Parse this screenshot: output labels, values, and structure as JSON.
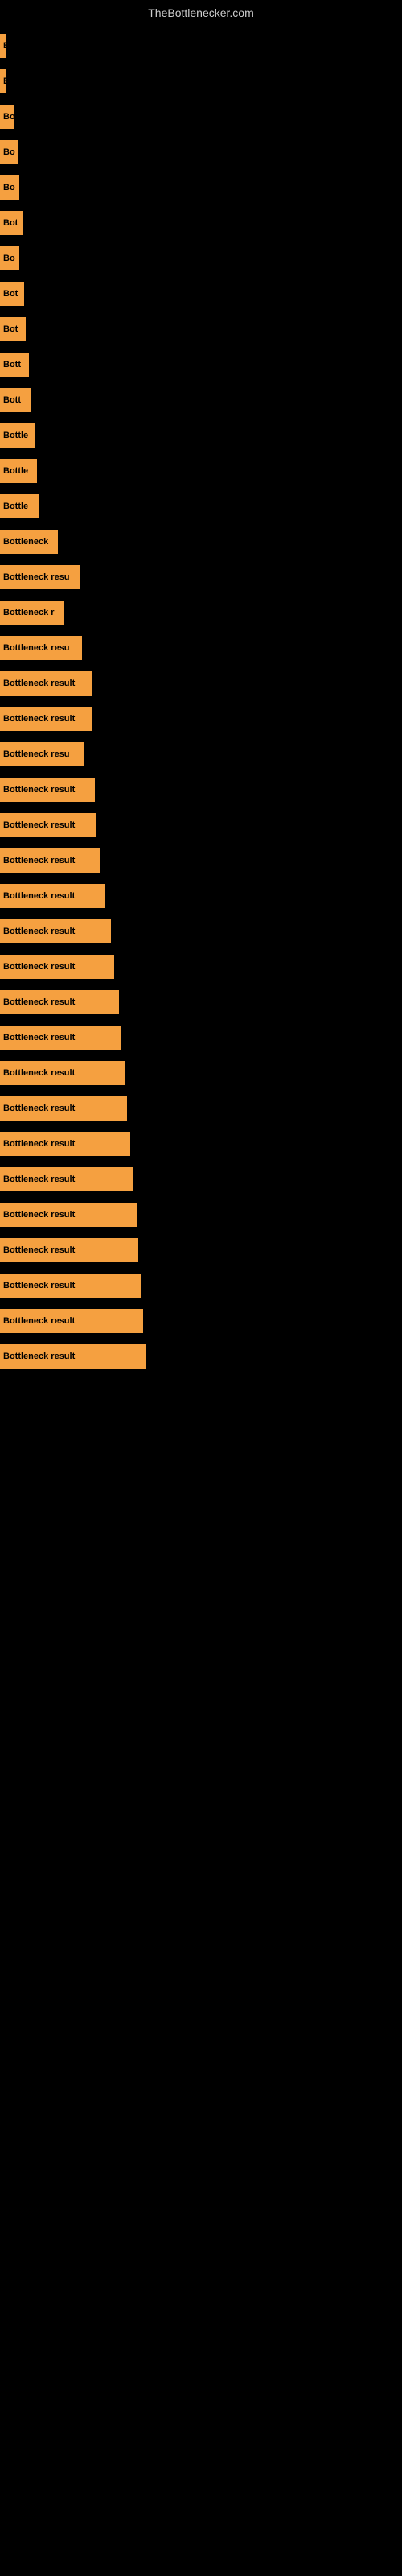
{
  "header": {
    "title": "TheBottlenecker.com"
  },
  "bars": [
    {
      "label": "B",
      "width": 8
    },
    {
      "label": "B",
      "width": 8
    },
    {
      "label": "Bo",
      "width": 18
    },
    {
      "label": "Bo",
      "width": 22
    },
    {
      "label": "Bo",
      "width": 24
    },
    {
      "label": "Bot",
      "width": 28
    },
    {
      "label": "Bo",
      "width": 24
    },
    {
      "label": "Bot",
      "width": 30
    },
    {
      "label": "Bot",
      "width": 32
    },
    {
      "label": "Bott",
      "width": 36
    },
    {
      "label": "Bott",
      "width": 38
    },
    {
      "label": "Bottle",
      "width": 44
    },
    {
      "label": "Bottle",
      "width": 46
    },
    {
      "label": "Bottle",
      "width": 48
    },
    {
      "label": "Bottleneck",
      "width": 72
    },
    {
      "label": "Bottleneck resu",
      "width": 100
    },
    {
      "label": "Bottleneck r",
      "width": 80
    },
    {
      "label": "Bottleneck resu",
      "width": 102
    },
    {
      "label": "Bottleneck result",
      "width": 115
    },
    {
      "label": "Bottleneck result",
      "width": 115
    },
    {
      "label": "Bottleneck resu",
      "width": 105
    },
    {
      "label": "Bottleneck result",
      "width": 118
    },
    {
      "label": "Bottleneck result",
      "width": 120
    },
    {
      "label": "Bottleneck result",
      "width": 124
    },
    {
      "label": "Bottleneck result",
      "width": 130
    },
    {
      "label": "Bottleneck result",
      "width": 138
    },
    {
      "label": "Bottleneck result",
      "width": 142
    },
    {
      "label": "Bottleneck result",
      "width": 148
    },
    {
      "label": "Bottleneck result",
      "width": 150
    },
    {
      "label": "Bottleneck result",
      "width": 155
    },
    {
      "label": "Bottleneck result",
      "width": 158
    },
    {
      "label": "Bottleneck result",
      "width": 162
    },
    {
      "label": "Bottleneck result",
      "width": 166
    },
    {
      "label": "Bottleneck result",
      "width": 170
    },
    {
      "label": "Bottleneck result",
      "width": 172
    },
    {
      "label": "Bottleneck result",
      "width": 175
    },
    {
      "label": "Bottleneck result",
      "width": 178
    },
    {
      "label": "Bottleneck result",
      "width": 182
    }
  ]
}
